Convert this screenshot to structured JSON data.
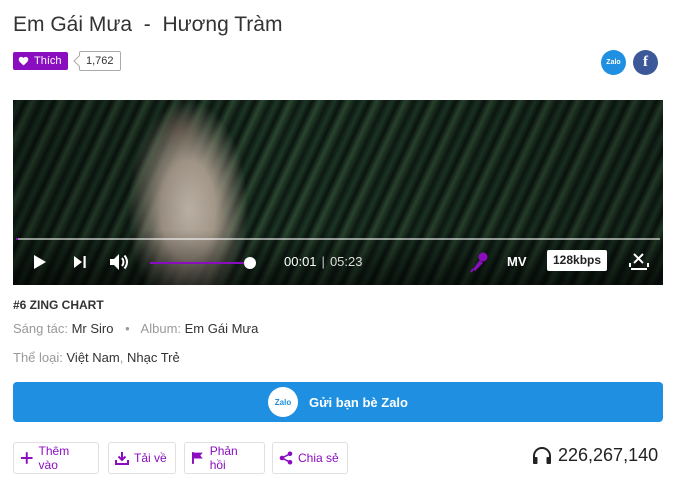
{
  "song": {
    "title": "Em Gái Mưa",
    "separator": "-",
    "artist": "Hương Tràm"
  },
  "like": {
    "label": "Thích",
    "count": "1,762"
  },
  "share_icons": {
    "zalo": "Zalo",
    "facebook": "f"
  },
  "player": {
    "current_time": "00:01",
    "time_separator": "|",
    "duration": "05:23",
    "progress_fraction": 0.003,
    "volume_fraction": 1.0,
    "mv_label": "MV",
    "quality_label": "128kbps",
    "icons": [
      "play-icon",
      "next-icon",
      "volume-icon",
      "karaoke-mic-icon",
      "minimize-icon"
    ]
  },
  "info": {
    "chart_rank": "#6 ZING CHART",
    "composer_label": "Sáng tác:",
    "composer": "Mr Siro",
    "bullet": "•",
    "album_label": "Album:",
    "album": "Em Gái Mưa",
    "genre_label": "Thể loại:",
    "genre_1": "Việt Nam",
    "genre_sep": ",",
    "genre_2": "Nhạc Trẻ"
  },
  "zalo_button": {
    "icon_text": "Zalo",
    "label": "Gửi bạn bè Zalo"
  },
  "actions": {
    "add": "Thêm vào",
    "download": "Tải về",
    "report": "Phản hồi",
    "share": "Chia sẻ"
  },
  "listen_count": "226,267,140",
  "colors": {
    "accent": "#8a0dbf",
    "zalo_blue": "#1e8fe1",
    "facebook_blue": "#3b5998"
  }
}
